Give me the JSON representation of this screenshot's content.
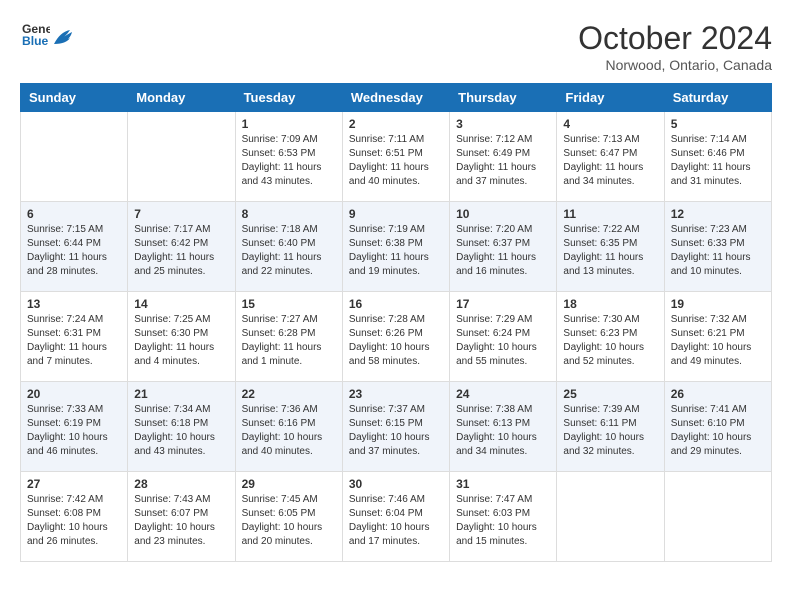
{
  "header": {
    "logo_line1": "General",
    "logo_line2": "Blue",
    "month": "October 2024",
    "location": "Norwood, Ontario, Canada"
  },
  "days_of_week": [
    "Sunday",
    "Monday",
    "Tuesday",
    "Wednesday",
    "Thursday",
    "Friday",
    "Saturday"
  ],
  "weeks": [
    [
      {
        "day": "",
        "sunrise": "",
        "sunset": "",
        "daylight": ""
      },
      {
        "day": "",
        "sunrise": "",
        "sunset": "",
        "daylight": ""
      },
      {
        "day": "1",
        "sunrise": "Sunrise: 7:09 AM",
        "sunset": "Sunset: 6:53 PM",
        "daylight": "Daylight: 11 hours and 43 minutes."
      },
      {
        "day": "2",
        "sunrise": "Sunrise: 7:11 AM",
        "sunset": "Sunset: 6:51 PM",
        "daylight": "Daylight: 11 hours and 40 minutes."
      },
      {
        "day": "3",
        "sunrise": "Sunrise: 7:12 AM",
        "sunset": "Sunset: 6:49 PM",
        "daylight": "Daylight: 11 hours and 37 minutes."
      },
      {
        "day": "4",
        "sunrise": "Sunrise: 7:13 AM",
        "sunset": "Sunset: 6:47 PM",
        "daylight": "Daylight: 11 hours and 34 minutes."
      },
      {
        "day": "5",
        "sunrise": "Sunrise: 7:14 AM",
        "sunset": "Sunset: 6:46 PM",
        "daylight": "Daylight: 11 hours and 31 minutes."
      }
    ],
    [
      {
        "day": "6",
        "sunrise": "Sunrise: 7:15 AM",
        "sunset": "Sunset: 6:44 PM",
        "daylight": "Daylight: 11 hours and 28 minutes."
      },
      {
        "day": "7",
        "sunrise": "Sunrise: 7:17 AM",
        "sunset": "Sunset: 6:42 PM",
        "daylight": "Daylight: 11 hours and 25 minutes."
      },
      {
        "day": "8",
        "sunrise": "Sunrise: 7:18 AM",
        "sunset": "Sunset: 6:40 PM",
        "daylight": "Daylight: 11 hours and 22 minutes."
      },
      {
        "day": "9",
        "sunrise": "Sunrise: 7:19 AM",
        "sunset": "Sunset: 6:38 PM",
        "daylight": "Daylight: 11 hours and 19 minutes."
      },
      {
        "day": "10",
        "sunrise": "Sunrise: 7:20 AM",
        "sunset": "Sunset: 6:37 PM",
        "daylight": "Daylight: 11 hours and 16 minutes."
      },
      {
        "day": "11",
        "sunrise": "Sunrise: 7:22 AM",
        "sunset": "Sunset: 6:35 PM",
        "daylight": "Daylight: 11 hours and 13 minutes."
      },
      {
        "day": "12",
        "sunrise": "Sunrise: 7:23 AM",
        "sunset": "Sunset: 6:33 PM",
        "daylight": "Daylight: 11 hours and 10 minutes."
      }
    ],
    [
      {
        "day": "13",
        "sunrise": "Sunrise: 7:24 AM",
        "sunset": "Sunset: 6:31 PM",
        "daylight": "Daylight: 11 hours and 7 minutes."
      },
      {
        "day": "14",
        "sunrise": "Sunrise: 7:25 AM",
        "sunset": "Sunset: 6:30 PM",
        "daylight": "Daylight: 11 hours and 4 minutes."
      },
      {
        "day": "15",
        "sunrise": "Sunrise: 7:27 AM",
        "sunset": "Sunset: 6:28 PM",
        "daylight": "Daylight: 11 hours and 1 minute."
      },
      {
        "day": "16",
        "sunrise": "Sunrise: 7:28 AM",
        "sunset": "Sunset: 6:26 PM",
        "daylight": "Daylight: 10 hours and 58 minutes."
      },
      {
        "day": "17",
        "sunrise": "Sunrise: 7:29 AM",
        "sunset": "Sunset: 6:24 PM",
        "daylight": "Daylight: 10 hours and 55 minutes."
      },
      {
        "day": "18",
        "sunrise": "Sunrise: 7:30 AM",
        "sunset": "Sunset: 6:23 PM",
        "daylight": "Daylight: 10 hours and 52 minutes."
      },
      {
        "day": "19",
        "sunrise": "Sunrise: 7:32 AM",
        "sunset": "Sunset: 6:21 PM",
        "daylight": "Daylight: 10 hours and 49 minutes."
      }
    ],
    [
      {
        "day": "20",
        "sunrise": "Sunrise: 7:33 AM",
        "sunset": "Sunset: 6:19 PM",
        "daylight": "Daylight: 10 hours and 46 minutes."
      },
      {
        "day": "21",
        "sunrise": "Sunrise: 7:34 AM",
        "sunset": "Sunset: 6:18 PM",
        "daylight": "Daylight: 10 hours and 43 minutes."
      },
      {
        "day": "22",
        "sunrise": "Sunrise: 7:36 AM",
        "sunset": "Sunset: 6:16 PM",
        "daylight": "Daylight: 10 hours and 40 minutes."
      },
      {
        "day": "23",
        "sunrise": "Sunrise: 7:37 AM",
        "sunset": "Sunset: 6:15 PM",
        "daylight": "Daylight: 10 hours and 37 minutes."
      },
      {
        "day": "24",
        "sunrise": "Sunrise: 7:38 AM",
        "sunset": "Sunset: 6:13 PM",
        "daylight": "Daylight: 10 hours and 34 minutes."
      },
      {
        "day": "25",
        "sunrise": "Sunrise: 7:39 AM",
        "sunset": "Sunset: 6:11 PM",
        "daylight": "Daylight: 10 hours and 32 minutes."
      },
      {
        "day": "26",
        "sunrise": "Sunrise: 7:41 AM",
        "sunset": "Sunset: 6:10 PM",
        "daylight": "Daylight: 10 hours and 29 minutes."
      }
    ],
    [
      {
        "day": "27",
        "sunrise": "Sunrise: 7:42 AM",
        "sunset": "Sunset: 6:08 PM",
        "daylight": "Daylight: 10 hours and 26 minutes."
      },
      {
        "day": "28",
        "sunrise": "Sunrise: 7:43 AM",
        "sunset": "Sunset: 6:07 PM",
        "daylight": "Daylight: 10 hours and 23 minutes."
      },
      {
        "day": "29",
        "sunrise": "Sunrise: 7:45 AM",
        "sunset": "Sunset: 6:05 PM",
        "daylight": "Daylight: 10 hours and 20 minutes."
      },
      {
        "day": "30",
        "sunrise": "Sunrise: 7:46 AM",
        "sunset": "Sunset: 6:04 PM",
        "daylight": "Daylight: 10 hours and 17 minutes."
      },
      {
        "day": "31",
        "sunrise": "Sunrise: 7:47 AM",
        "sunset": "Sunset: 6:03 PM",
        "daylight": "Daylight: 10 hours and 15 minutes."
      },
      {
        "day": "",
        "sunrise": "",
        "sunset": "",
        "daylight": ""
      },
      {
        "day": "",
        "sunrise": "",
        "sunset": "",
        "daylight": ""
      }
    ]
  ]
}
